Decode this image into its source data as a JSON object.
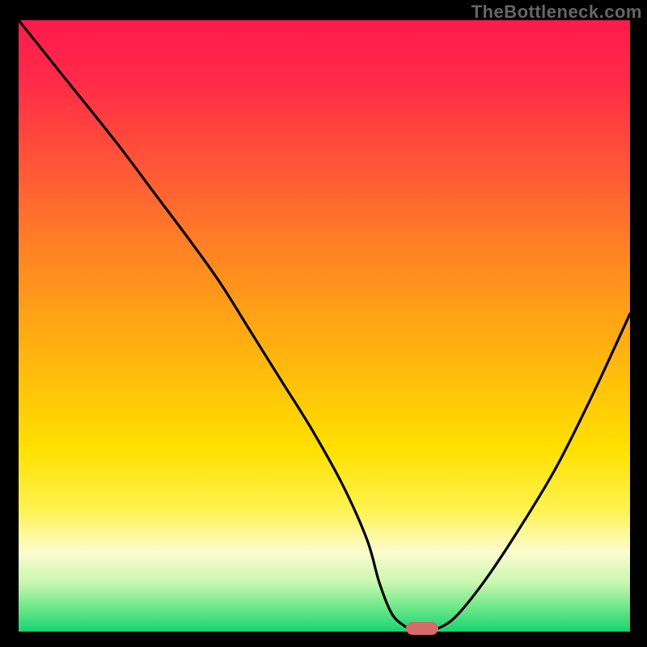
{
  "watermark": "TheBottleneck.com",
  "colors": {
    "background": "#000000",
    "gradient_stops": [
      {
        "offset": 0,
        "color": "#ff1a4d"
      },
      {
        "offset": 10,
        "color": "#ff2b48"
      },
      {
        "offset": 25,
        "color": "#ff5a35"
      },
      {
        "offset": 40,
        "color": "#ff8a20"
      },
      {
        "offset": 55,
        "color": "#ffb50f"
      },
      {
        "offset": 70,
        "color": "#ffe000"
      },
      {
        "offset": 80,
        "color": "#fff250"
      },
      {
        "offset": 87,
        "color": "#fcfccf"
      },
      {
        "offset": 92,
        "color": "#c9f7b0"
      },
      {
        "offset": 96,
        "color": "#6ee88b"
      },
      {
        "offset": 100,
        "color": "#17d36f"
      }
    ],
    "curve": "#000000",
    "marker": "#d66b6b"
  },
  "chart_data": {
    "type": "line",
    "title": "",
    "xlabel": "",
    "ylabel": "",
    "xlim": [
      0,
      100
    ],
    "ylim": [
      0,
      100
    ],
    "grid": false,
    "legend": false,
    "series": [
      {
        "name": "bottleneck-curve",
        "x": [
          0,
          8,
          16,
          22,
          28,
          33,
          38,
          43,
          48,
          53,
          57,
          59,
          61,
          63,
          65,
          67,
          71,
          76,
          82,
          88,
          94,
          100
        ],
        "y": [
          100,
          90,
          80,
          72,
          64,
          57,
          49,
          41,
          33,
          24,
          15,
          8,
          3,
          1,
          0,
          0,
          2,
          8,
          17,
          27,
          39,
          52
        ]
      }
    ],
    "annotations": [
      {
        "name": "optimal-marker",
        "x": 66,
        "y": 0.5,
        "shape": "pill",
        "color": "#d66b6b"
      }
    ]
  }
}
